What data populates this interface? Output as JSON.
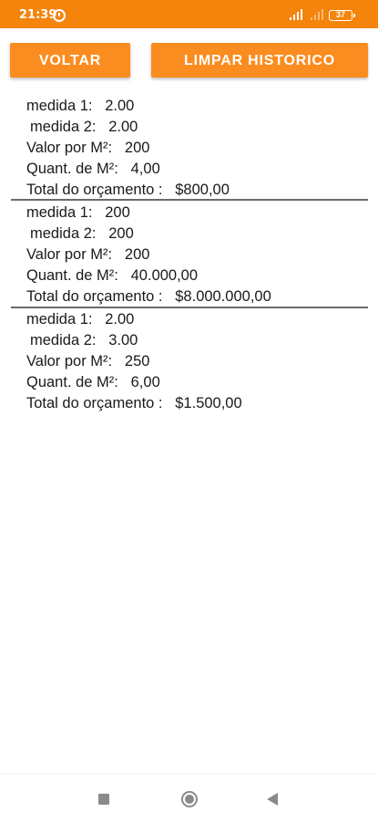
{
  "status_bar": {
    "time": "21:39",
    "battery": "37",
    "color": "#f4840c"
  },
  "toolbar": {
    "back_label": "VOLTAR",
    "clear_label": "LIMPAR HISTORICO",
    "button_color": "#fb8c1f"
  },
  "history": [
    {
      "medida1": "medida 1:   2.00",
      "medida2": "medida 2:   2.00",
      "valor_m2": "Valor por M²:   200",
      "quant_m2": "Quant. de M²:   4,00",
      "total": "Total do orçamento :   $800,00"
    },
    {
      "medida1": "medida 1:   200",
      "medida2": "medida 2:   200",
      "valor_m2": "Valor por M²:   200",
      "quant_m2": "Quant. de M²:   40.000,00",
      "total": "Total do orçamento :   $8.000.000,00"
    },
    {
      "medida1": "medida 1:   2.00",
      "medida2": "medida 2:   3.00",
      "valor_m2": "Valor por M²:   250",
      "quant_m2": "Quant. de M²:   6,00",
      "total": "Total do orçamento :   $1.500,00"
    }
  ],
  "nav_bar": {
    "icons": [
      "recent-apps-icon",
      "home-icon",
      "back-icon"
    ]
  }
}
